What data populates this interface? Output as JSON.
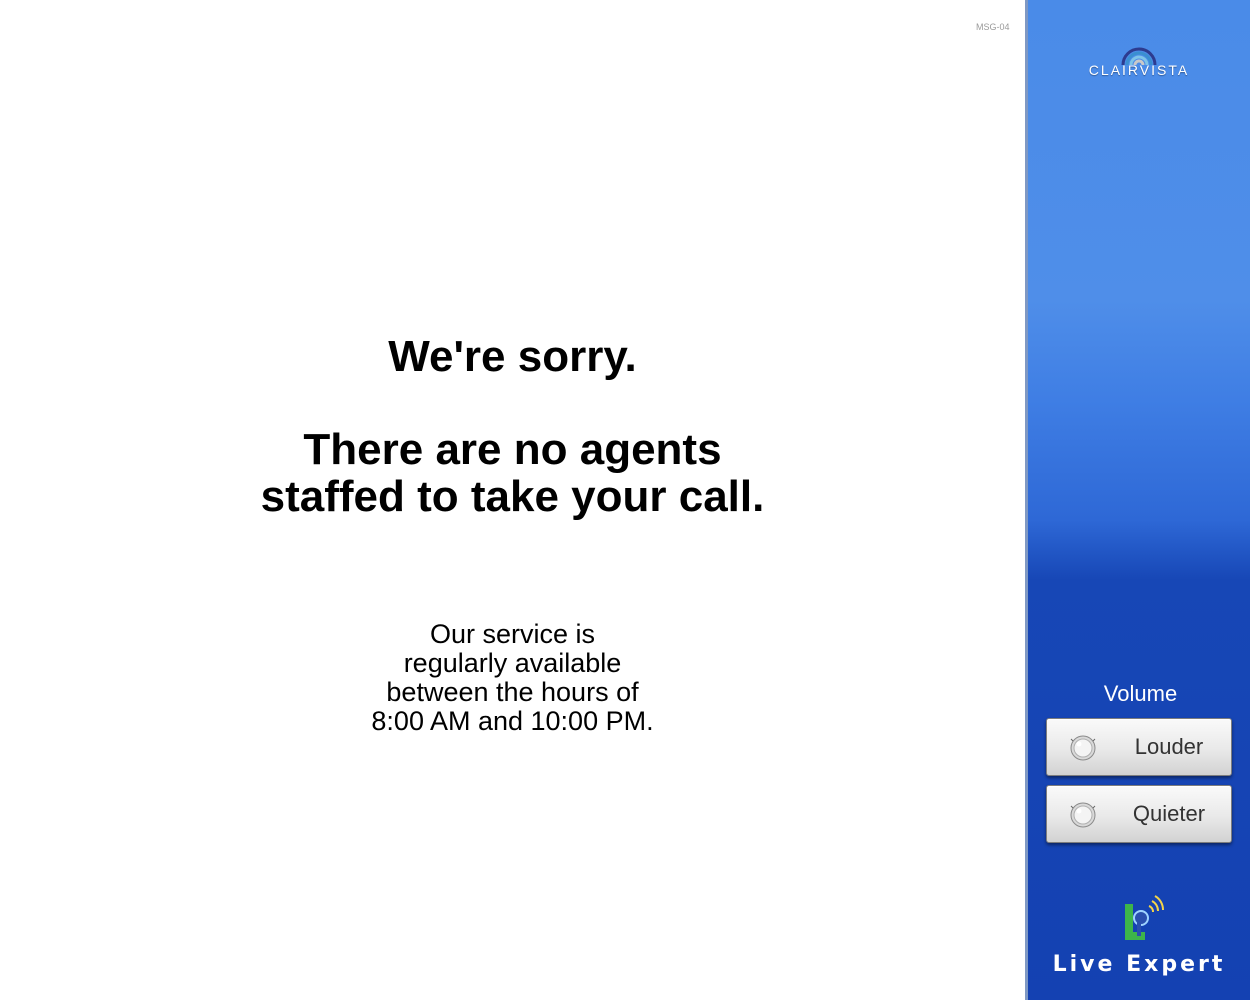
{
  "screen": {
    "code": "MSG-04"
  },
  "message": {
    "heading1": "We're sorry.",
    "heading2_line1": "There are no agents",
    "heading2_line2": "staffed to take your call.",
    "info_lines": [
      "Our service is",
      "regularly available",
      "between the hours of",
      "8:00 AM and 10:00 PM."
    ]
  },
  "sidebar": {
    "brand": {
      "name": "ClairVista",
      "icon": "clairvista-logo-icon"
    },
    "volume": {
      "label": "Volume",
      "louder_label": "Louder",
      "quieter_label": "Quieter",
      "knob_icon": "volume-knob-icon"
    },
    "footer_logo": {
      "text": "Live Expert",
      "icon": "live-expert-logo-icon"
    }
  },
  "colors": {
    "sidebar_top": "#4a8be8",
    "sidebar_bottom": "#1441b2",
    "button_face": "#e9e9e9",
    "logo_green": "#3db54a"
  }
}
